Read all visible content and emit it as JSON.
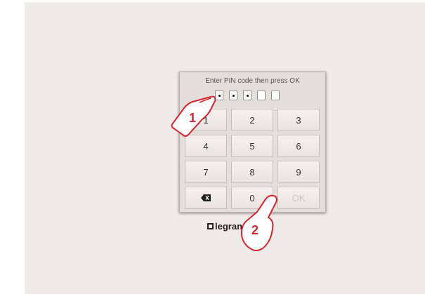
{
  "dialog": {
    "prompt": "Enter PIN code then press OK",
    "pin_slots": [
      true,
      true,
      true,
      false,
      false
    ]
  },
  "keypad": {
    "keys": [
      {
        "label": "1",
        "enabled": true
      },
      {
        "label": "2",
        "enabled": true
      },
      {
        "label": "3",
        "enabled": true
      },
      {
        "label": "4",
        "enabled": true
      },
      {
        "label": "5",
        "enabled": true
      },
      {
        "label": "6",
        "enabled": true
      },
      {
        "label": "7",
        "enabled": true
      },
      {
        "label": "8",
        "enabled": true
      },
      {
        "label": "9",
        "enabled": true
      },
      {
        "label": "",
        "icon": "backspace-icon",
        "enabled": true
      },
      {
        "label": "0",
        "enabled": true
      },
      {
        "label": "OK",
        "enabled": false
      }
    ]
  },
  "brand": {
    "logo_text": "legrand"
  },
  "annotations": {
    "step1": "1",
    "step2": "2",
    "color": "#d8242c"
  }
}
